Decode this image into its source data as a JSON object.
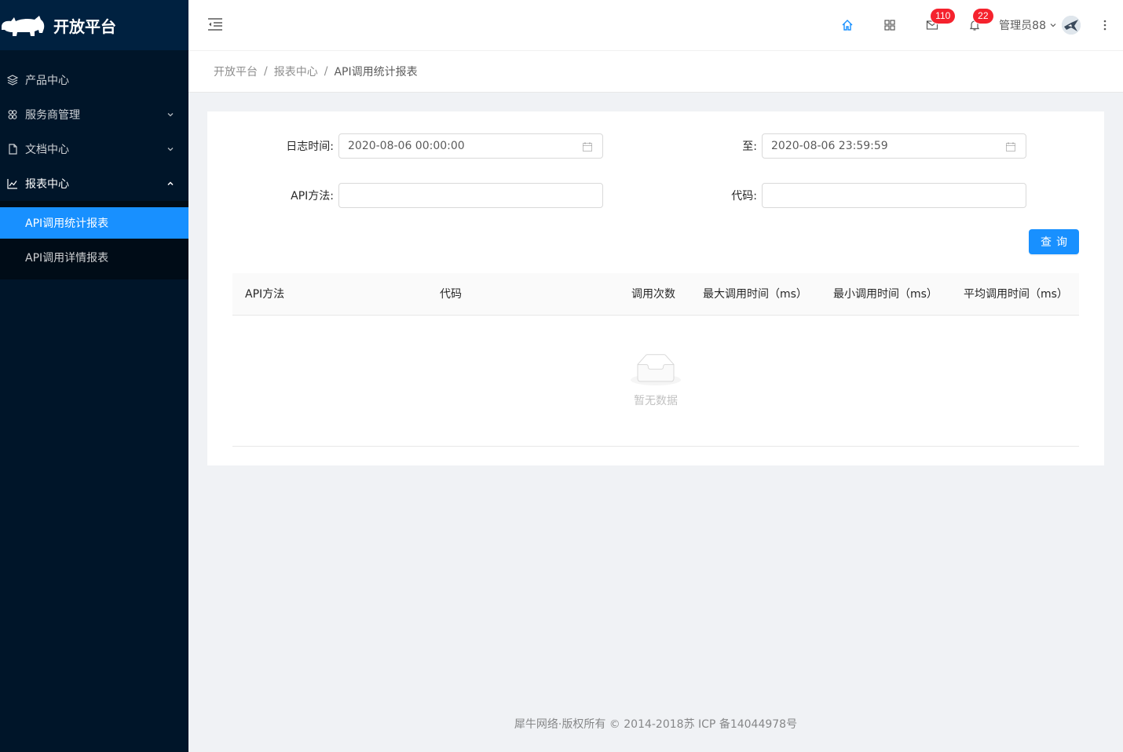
{
  "app": {
    "title": "开放平台"
  },
  "sidebar": {
    "items": [
      {
        "label": "产品中心",
        "icon": "layers-icon",
        "has_arrow": false
      },
      {
        "label": "服务商管理",
        "icon": "team-icon",
        "has_arrow": true
      },
      {
        "label": "文档中心",
        "icon": "file-icon",
        "has_arrow": true
      },
      {
        "label": "报表中心",
        "icon": "line-chart-icon",
        "has_arrow": true,
        "open": true
      }
    ],
    "sub_items": [
      {
        "label": "API调用统计报表",
        "active": true
      },
      {
        "label": "API调用详情报表",
        "active": false
      }
    ]
  },
  "header": {
    "mail_count": "110",
    "notice_count": "22",
    "user_name": "管理员88"
  },
  "breadcrumb": {
    "items": [
      "开放平台",
      "报表中心"
    ],
    "current": "API调用统计报表",
    "separator": "/"
  },
  "form": {
    "log_time_label": "日志时间:",
    "start_time": "2020-08-06 00:00:00",
    "to_label": "至:",
    "end_time": "2020-08-06 23:59:59",
    "api_method_label": "API方法:",
    "api_method_value": "",
    "code_label": "代码:",
    "code_value": "",
    "query_button": "查询"
  },
  "table": {
    "columns": [
      "API方法",
      "代码",
      "调用次数",
      "最大调用时间（ms）",
      "最小调用时间（ms）",
      "平均调用时间（ms）"
    ],
    "rows": [],
    "empty_text": "暂无数据"
  },
  "footer": {
    "text": "犀牛网络·版权所有 © 2014-2018苏 ICP 备14044978号"
  },
  "colors": {
    "primary": "#1890ff",
    "sidebar_bg": "#001529",
    "badge": "#f5222d"
  }
}
